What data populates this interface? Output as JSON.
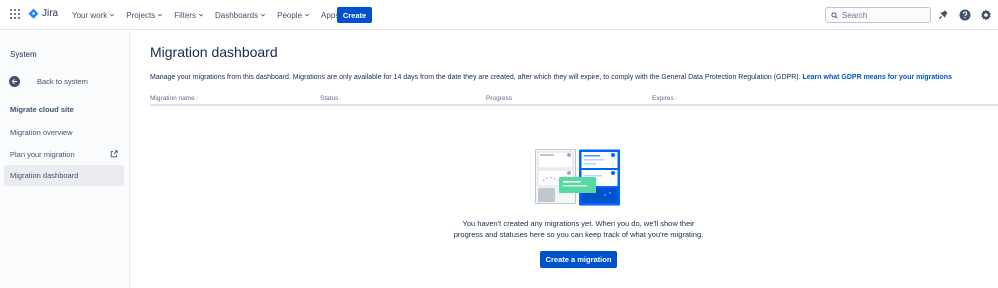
{
  "app": {
    "name": "Jira"
  },
  "topnav": {
    "items": [
      {
        "label": "Your work"
      },
      {
        "label": "Projects"
      },
      {
        "label": "Filters"
      },
      {
        "label": "Dashboards"
      },
      {
        "label": "People"
      },
      {
        "label": "Apps"
      }
    ],
    "create_label": "Create",
    "search_placeholder": "Search",
    "icons": [
      "notifications-icon",
      "help-icon",
      "settings-icon"
    ]
  },
  "sidebar": {
    "title": "System",
    "back_label": "Back to system",
    "section_label": "Migrate cloud site",
    "items": [
      {
        "label": "Migration overview",
        "active": false
      },
      {
        "label": "Plan your migration",
        "active": false,
        "external": true
      },
      {
        "label": "Migration dashboard",
        "active": true
      }
    ]
  },
  "main": {
    "title": "Migration dashboard",
    "description": "Manage your migrations from this dashboard. Migrations are only available for 14 days from the date they are created, after which they will expire, to comply with the General Data Protection Regulation (GDPR).",
    "description_link": "Learn what GDPR means for your migrations",
    "columns": [
      {
        "label": "Migration name",
        "sortable": true
      },
      {
        "label": "Status",
        "sortable": true
      },
      {
        "label": "Progress",
        "sortable": false
      },
      {
        "label": "Expires",
        "sortable": true
      }
    ],
    "empty_line1": "You haven't created any migrations yet. When you do, we'll show their",
    "empty_line2": "progress and statuses here so you can keep track of what you're migrating.",
    "cta_label": "Create a migration"
  },
  "colors": {
    "primary": "#0052cc",
    "text": "#172b4d",
    "subtle": "#42526e"
  }
}
